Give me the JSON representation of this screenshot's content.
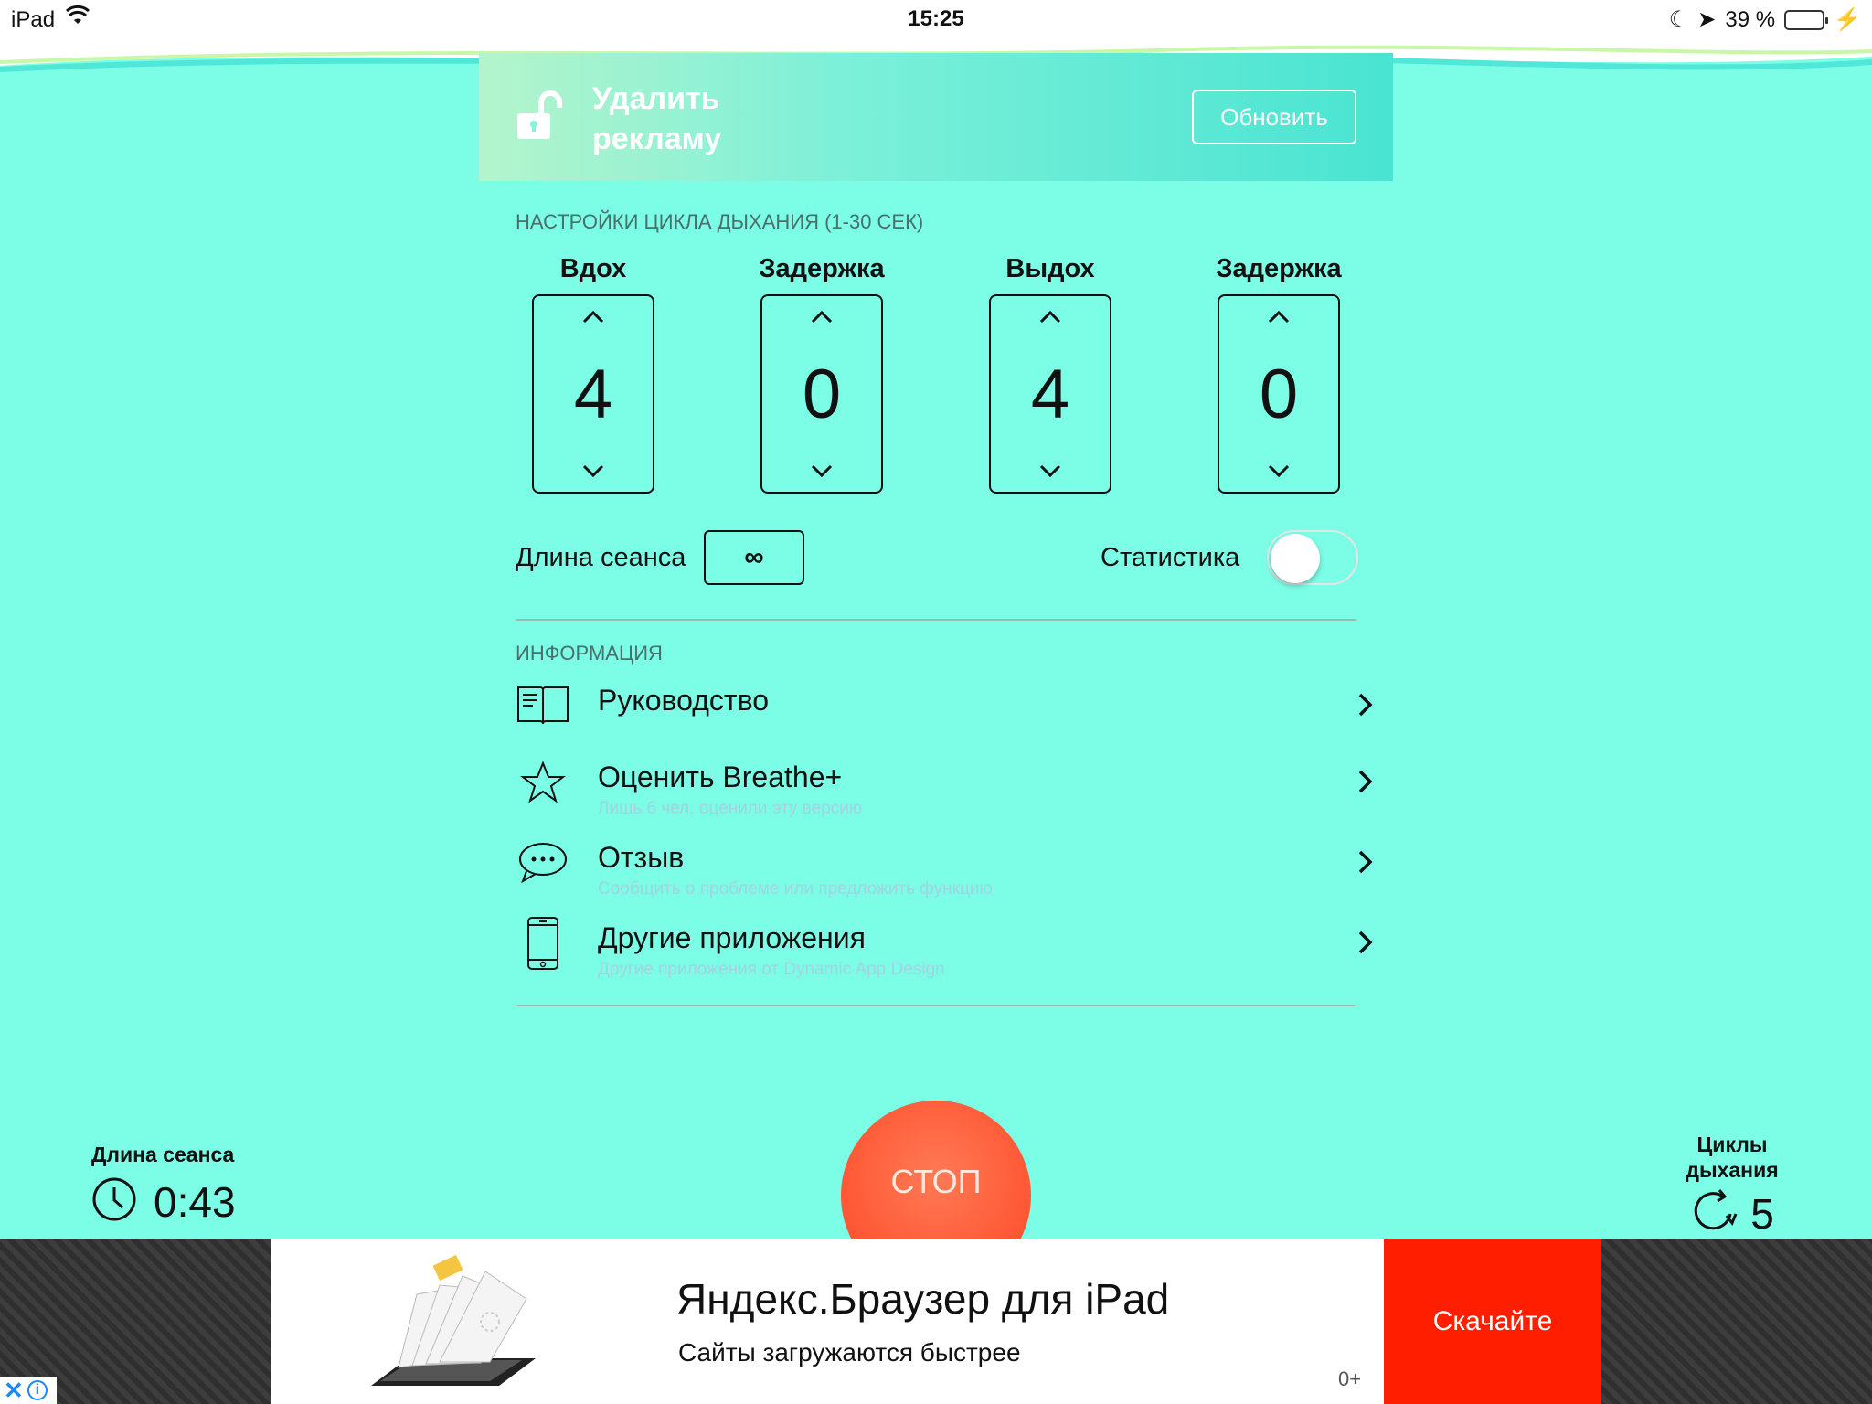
{
  "status_bar": {
    "device": "iPad",
    "time": "15:25",
    "battery": "39 %"
  },
  "promo": {
    "title": "Удалить рекламу",
    "update_label": "Обновить"
  },
  "breath_settings": {
    "header": "НАСТРОЙКИ ЦИКЛА ДЫХАНИЯ (1-30 СЕК)",
    "steppers": [
      {
        "label": "Вдох",
        "value": "4"
      },
      {
        "label": "Задержка",
        "value": "0"
      },
      {
        "label": "Выдох",
        "value": "4"
      },
      {
        "label": "Задержка",
        "value": "0"
      }
    ],
    "session_length_label": "Длина сеанса",
    "session_length_value": "∞",
    "statistics_label": "Статистика",
    "statistics_on": false
  },
  "info": {
    "header": "ИНФОРМАЦИЯ",
    "items": [
      {
        "title": "Руководство",
        "subtitle": "",
        "icon": "book-icon"
      },
      {
        "title": "Оценить Breathe+",
        "subtitle": "Лишь 6 чел. оценили эту версию",
        "icon": "star-icon"
      },
      {
        "title": "Отзыв",
        "subtitle": "Сообщить о проблеме или предложить функцию",
        "icon": "chat-bubble-icon"
      },
      {
        "title": "Другие приложения",
        "subtitle": "Другие приложения от Dynamic App Design",
        "icon": "phone-icon"
      }
    ]
  },
  "session_stats": {
    "length_label": "Длина сеанса",
    "length_value": "0:43",
    "cycles_label": "Циклы дыхания",
    "cycles_value": "5"
  },
  "stop_label": "СТОП",
  "bottom_ad": {
    "headline": "Яндекс.Браузер для iPad",
    "subline": "Сайты загружаются быстрее",
    "cta": "Скачайте",
    "age": "0+"
  },
  "colors": {
    "background": "#7bfde6",
    "stop_button": "#ff5a37",
    "ad_cta": "#ff1e00"
  }
}
